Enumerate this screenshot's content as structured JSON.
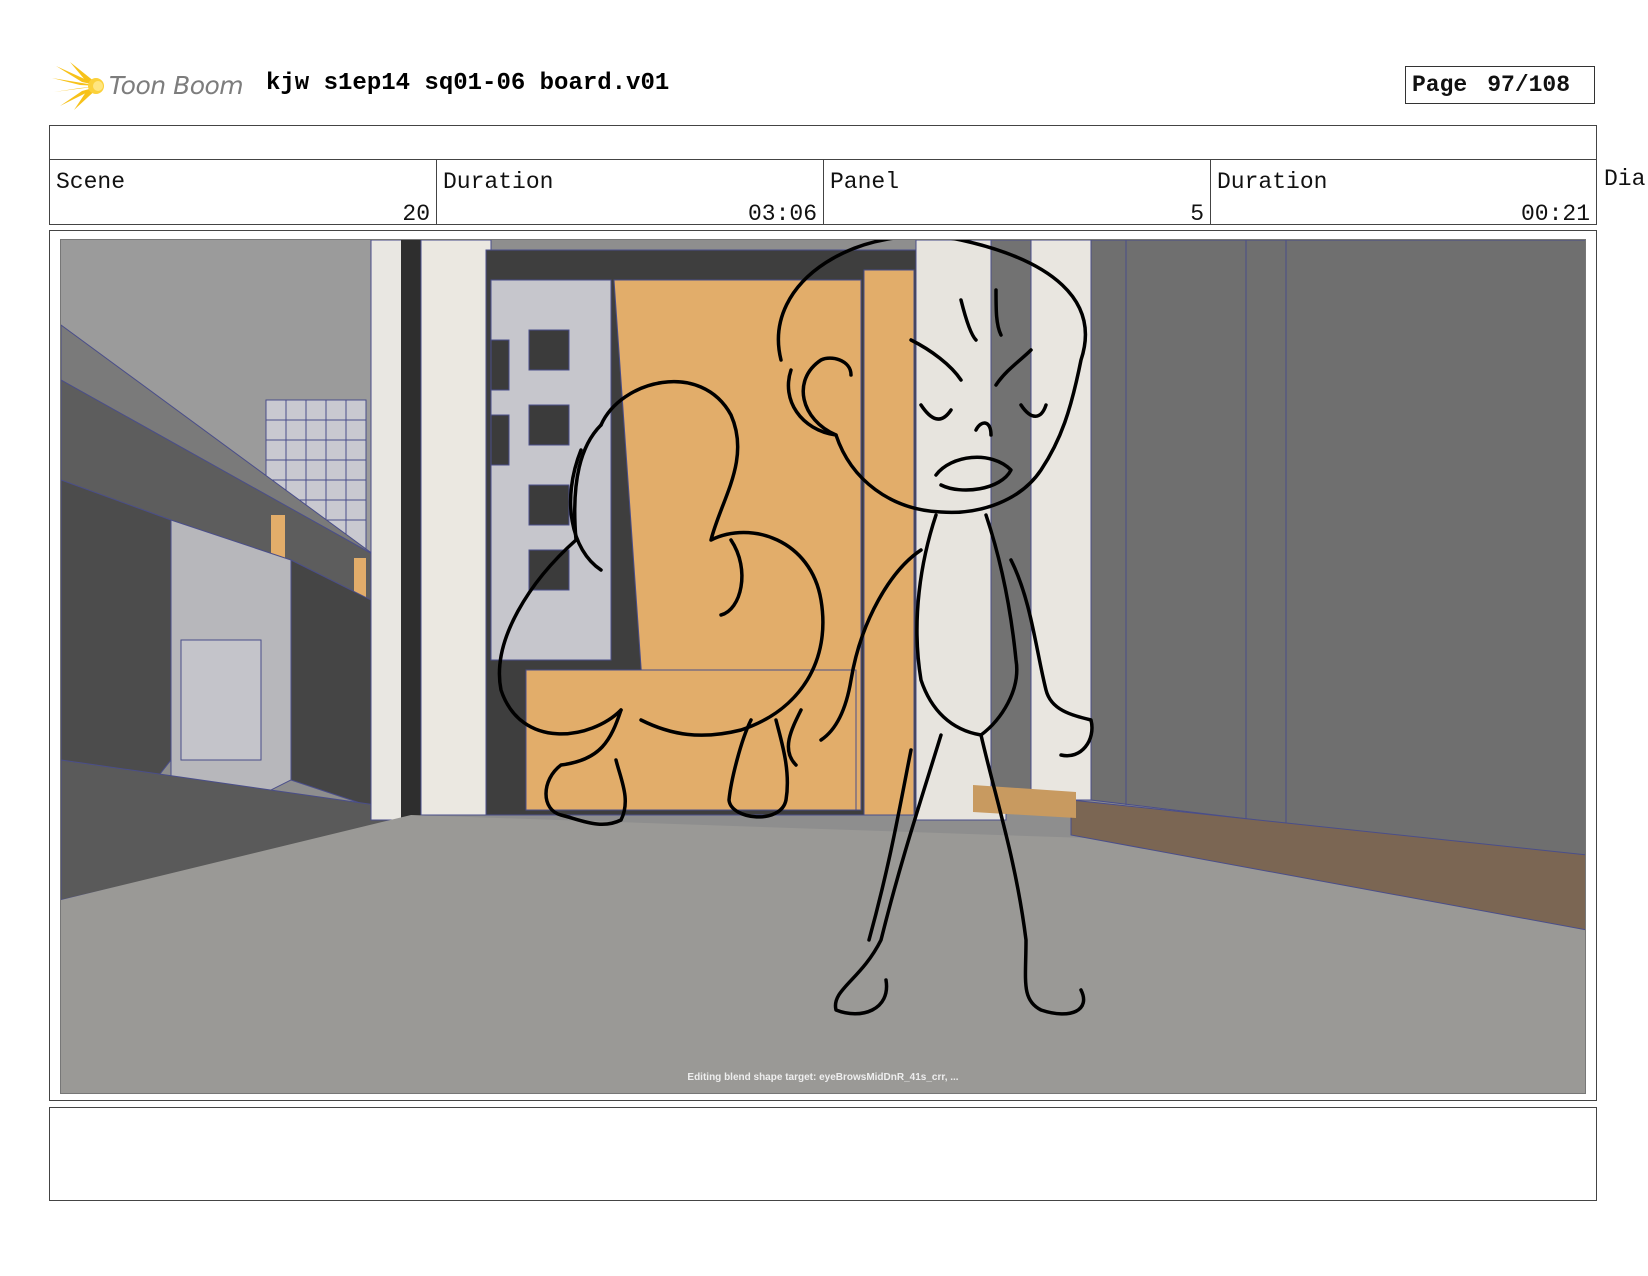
{
  "header": {
    "brand": "Toon Boom",
    "doc_title": "kjw s1ep14 sq01-06 board.v01",
    "page_label": "Page",
    "page_value": "97/108"
  },
  "info": {
    "scene_label": "Scene",
    "scene_value": "20",
    "scene_duration_label": "Duration",
    "scene_duration_value": "03:06",
    "panel_label": "Panel",
    "panel_value": "5",
    "panel_duration_label": "Duration",
    "panel_duration_value": "00:21",
    "dialogue_label": "Dia"
  },
  "frame": {
    "viewport_message": "Editing blend shape target: eyeBrowsMidDnR_41s_crr, ..."
  },
  "colors": {
    "accent_orange": "#e2ad6a",
    "wall_gray": "#6f6f6f",
    "floor_gray": "#9a9996",
    "wireframe": "#4a4e8a",
    "logo_yellow": "#f7c21a"
  }
}
